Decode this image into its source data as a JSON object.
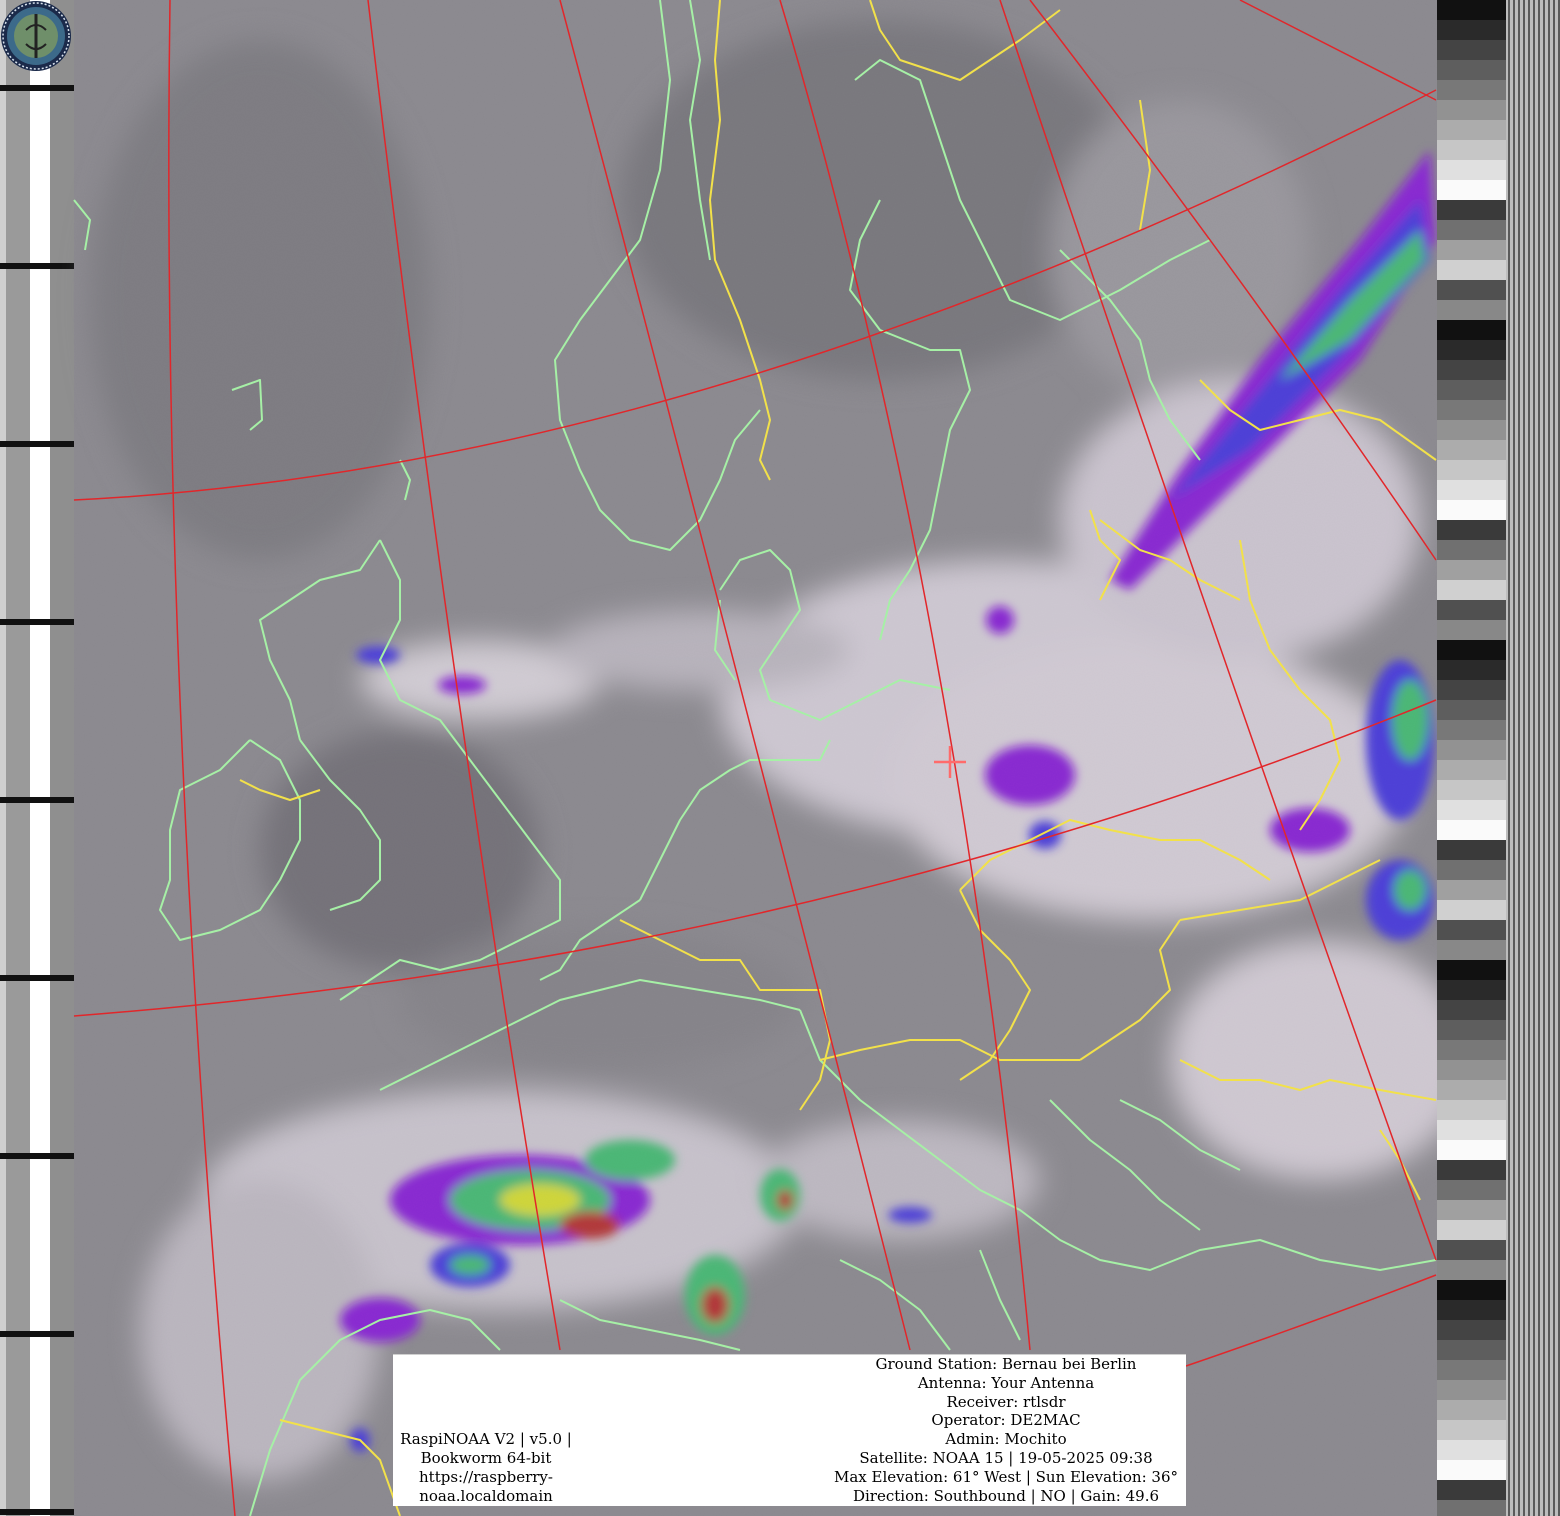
{
  "image": {
    "subject": "",
    "colors": {
      "land_line": "#a6f0a6",
      "border_line": "#f2e14a",
      "grid_line": "#e2262a",
      "cloud_base": "#8c8a90",
      "precip_purple": "#8a10e8",
      "precip_blue": "#3a2cf0",
      "precip_green": "#38c870",
      "precip_yellow": "#e6f020",
      "precip_red": "#c02020"
    }
  },
  "footer": {
    "software_line1": "RaspiNOAA V2 | v5.0 |",
    "software_line2": "Bookworm 64-bit",
    "software_line3": "https://raspberry-",
    "software_line4": "noaa.localdomain",
    "ground_station": "Ground Station: Bernau bei Berlin",
    "antenna": "Antenna: Your Antenna",
    "receiver": "Receiver: rtlsdr",
    "operator": "Operator: DE2MAC",
    "admin": "Admin: Mochito",
    "satellite": "Satellite: NOAA 15 | 19-05-2025 09:38",
    "elevation": "Max Elevation: 61° West | Sun Elevation: 36°",
    "direction": "Direction: Southbound | NO | Gain: 49.6"
  }
}
